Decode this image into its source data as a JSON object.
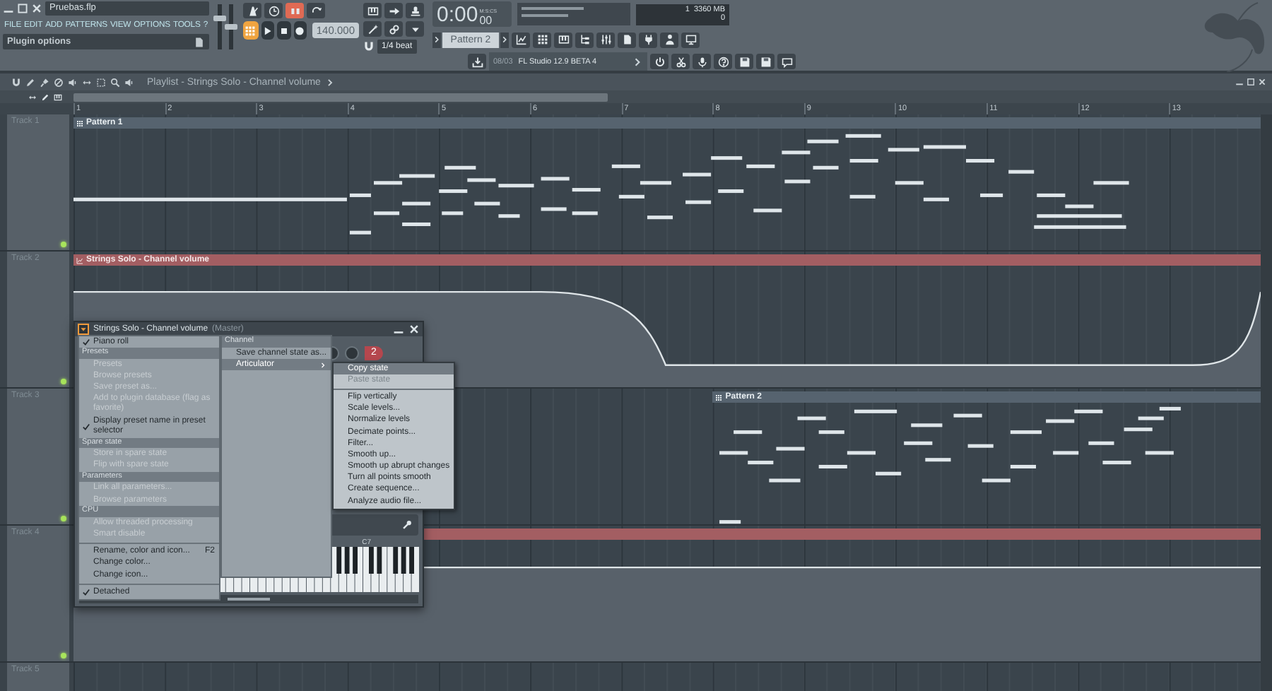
{
  "window": {
    "title": "Pruebas.flp"
  },
  "menu_bar": [
    "FILE",
    "EDIT",
    "ADD",
    "PATTERNS",
    "VIEW",
    "OPTIONS",
    "TOOLS",
    "?"
  ],
  "hint_bar": "Plugin options",
  "master": {
    "volume": {
      "level": 0.72
    },
    "pitch": {
      "level": 0.5
    }
  },
  "transport": {
    "countdown": true,
    "pattern_mode": true,
    "tempo": "140.000"
  },
  "snap": "1/4 beat",
  "time": {
    "value": "0:00",
    "centiseconds": "00",
    "unit": "M:S:CS"
  },
  "cpu": {
    "cores": "1",
    "memory": "3360 MB",
    "polyphony": "0"
  },
  "pattern_selector": "Pattern 2",
  "news": {
    "date": "08/03",
    "headline": "FL Studio 12.9 BETA 4"
  },
  "playlist": {
    "title": "Playlist - Strings Solo - Channel volume",
    "bars": [
      "1",
      "2",
      "3",
      "4",
      "5",
      "6",
      "7",
      "8",
      "9",
      "10",
      "11",
      "12",
      "13"
    ],
    "tracks": [
      {
        "name": "Track 1",
        "enabled": true,
        "clips": [
          {
            "kind": "pattern",
            "label": "Pattern 1"
          }
        ]
      },
      {
        "name": "Track 2",
        "enabled": true,
        "clips": [
          {
            "kind": "automation",
            "label": "Strings Solo - Channel volume"
          }
        ]
      },
      {
        "name": "Track 3",
        "enabled": true,
        "clips": [
          {
            "kind": "pattern",
            "label": "Pattern 2"
          }
        ]
      },
      {
        "name": "Track 4",
        "enabled": true,
        "clips": [
          {
            "kind": "automation"
          }
        ]
      },
      {
        "name": "Track 5"
      }
    ]
  },
  "plugin_window": {
    "title": "Strings Solo - Channel volume",
    "target": "(Master)",
    "channel": "2",
    "octave_label": "C7"
  },
  "plugin_menu": [
    {
      "kind": "item",
      "label": "Piano roll",
      "checked": true,
      "disabled": false
    },
    {
      "kind": "header",
      "label": "Presets"
    },
    {
      "kind": "item",
      "label": "Presets",
      "checked": false,
      "disabled": true
    },
    {
      "kind": "item",
      "label": "Browse presets",
      "checked": false,
      "disabled": true
    },
    {
      "kind": "item",
      "label": "Save preset as...",
      "checked": false,
      "disabled": true
    },
    {
      "kind": "item",
      "label": "Add to plugin database (flag as favorite)",
      "checked": false,
      "disabled": true
    },
    {
      "kind": "item",
      "label": "Display preset name in preset selector",
      "checked": true,
      "disabled": false
    },
    {
      "kind": "header",
      "label": "Spare state"
    },
    {
      "kind": "item",
      "label": "Store in spare state",
      "checked": false,
      "disabled": true
    },
    {
      "kind": "item",
      "label": "Flip with spare state",
      "checked": false,
      "disabled": true
    },
    {
      "kind": "header",
      "label": "Parameters"
    },
    {
      "kind": "item",
      "label": "Link all parameters...",
      "checked": false,
      "disabled": true
    },
    {
      "kind": "item",
      "label": "Browse parameters",
      "checked": false,
      "disabled": true
    },
    {
      "kind": "header",
      "label": "CPU"
    },
    {
      "kind": "item",
      "label": "Allow threaded processing",
      "checked": false,
      "disabled": true
    },
    {
      "kind": "item",
      "label": "Smart disable",
      "checked": false,
      "disabled": true
    },
    {
      "kind": "separator"
    },
    {
      "kind": "item",
      "label": "Rename, color and icon...",
      "shortcut": "F2",
      "checked": false,
      "disabled": false
    },
    {
      "kind": "item",
      "label": "Change color...",
      "checked": false,
      "disabled": false
    },
    {
      "kind": "item",
      "label": "Change icon...",
      "checked": false,
      "disabled": false
    },
    {
      "kind": "separator"
    },
    {
      "kind": "item",
      "label": "Detached",
      "checked": true,
      "disabled": false
    }
  ],
  "channel_menu": [
    {
      "kind": "header",
      "label": "Channel"
    },
    {
      "kind": "item",
      "label": "Save channel state as...",
      "selected": false
    },
    {
      "kind": "submenu",
      "label": "Articulator",
      "selected": true
    }
  ],
  "articulator_menu": [
    {
      "kind": "item",
      "label": "Copy state",
      "selected": true,
      "disabled": false
    },
    {
      "kind": "item",
      "label": "Paste state",
      "selected": false,
      "disabled": true
    },
    {
      "kind": "separator"
    },
    {
      "kind": "item",
      "label": "Flip vertically",
      "selected": false,
      "disabled": false
    },
    {
      "kind": "item",
      "label": "Scale levels...",
      "selected": false,
      "disabled": false
    },
    {
      "kind": "item",
      "label": "Normalize levels",
      "selected": false,
      "disabled": false
    },
    {
      "kind": "item",
      "label": "Decimate points...",
      "selected": false,
      "disabled": false
    },
    {
      "kind": "item",
      "label": "Filter...",
      "selected": false,
      "disabled": false
    },
    {
      "kind": "item",
      "label": "Smooth up...",
      "selected": false,
      "disabled": false
    },
    {
      "kind": "item",
      "label": "Smooth up abrupt changes",
      "selected": false,
      "disabled": false
    },
    {
      "kind": "item",
      "label": "Turn all points smooth",
      "selected": false,
      "disabled": false
    },
    {
      "kind": "item",
      "label": "Create sequence...",
      "selected": false,
      "disabled": false
    },
    {
      "kind": "item",
      "label": "Analyze audio file...",
      "selected": false,
      "disabled": false
    }
  ]
}
